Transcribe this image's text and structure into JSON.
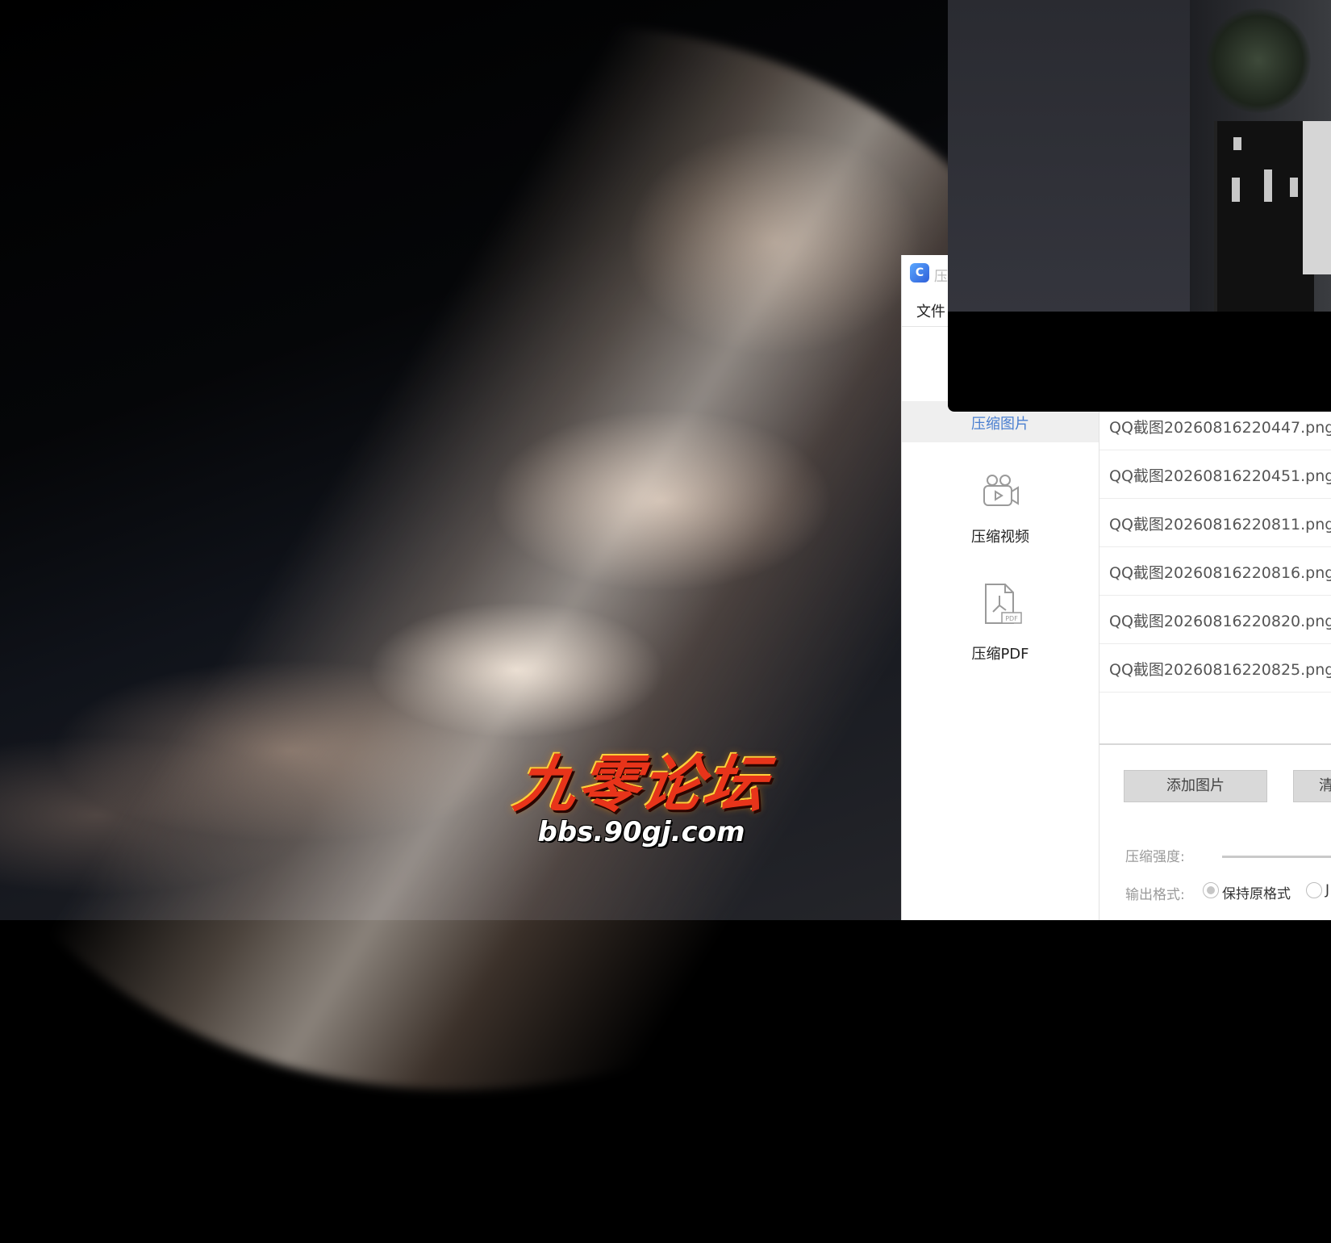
{
  "wallpaper": {
    "watermark_title": "九零论坛",
    "watermark_url": "bbs.90gj.com"
  },
  "app": {
    "icon_name": "compressor-app-icon",
    "icon_glyph": "C",
    "title": "压",
    "menu": {
      "file": "文件"
    },
    "sidebar": {
      "items": [
        {
          "label": "压缩图片",
          "icon": "image-icon",
          "active": true
        },
        {
          "label": "压缩视频",
          "icon": "video-camera-icon",
          "active": false
        },
        {
          "label": "压缩PDF",
          "icon": "pdf-file-icon",
          "active": false
        }
      ]
    },
    "files": [
      "QQ截图20260816220447.png",
      "QQ截图20260816220451.png",
      "QQ截图20260816220811.png",
      "QQ截图20260816220816.png",
      "QQ截图20260816220820.png",
      "QQ截图20260816220825.png"
    ],
    "buttons": {
      "add_image": "添加图片",
      "second": "清"
    },
    "options": {
      "strength_label": "压缩强度:",
      "format_label": "输出格式:",
      "format_keep": "保持原格式",
      "format_other": "J"
    },
    "pdf_badge": "PDF"
  },
  "colors": {
    "accent": "#4a7fd0",
    "logo_red": "#e8341a"
  }
}
